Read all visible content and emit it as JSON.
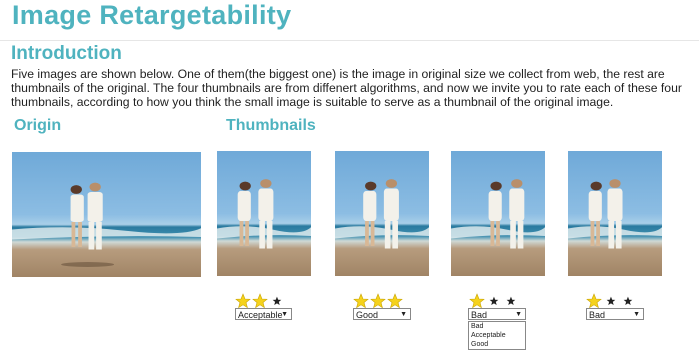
{
  "page_title": "Image Retargetability",
  "intro": {
    "heading": "Introduction",
    "text": "Five images are shown below. One of them(the biggest one) is the image in original size we collect from web, the rest are thumbnails of the original. The four thumbnails are from diffenert algorithms, and now we invite you to rate each of these four thumbnails, according to how you think the small image is suitable to serve as a thumbnail of the original image."
  },
  "origin_heading": "Origin",
  "thumbnails_heading": "Thumbnails",
  "thumbnails": [
    {
      "rating": "Acceptable",
      "stars_filled": 2
    },
    {
      "rating": "Good",
      "stars_filled": 3
    },
    {
      "rating": "Bad",
      "stars_filled": 1
    },
    {
      "rating": "Bad",
      "stars_filled": 1
    }
  ],
  "open_dropdown_options": [
    "Bad",
    "Acceptable",
    "Good"
  ],
  "colors": {
    "heading": "#4fb3bf",
    "star_filled": "#f5d21c",
    "star_empty": "#222222"
  }
}
